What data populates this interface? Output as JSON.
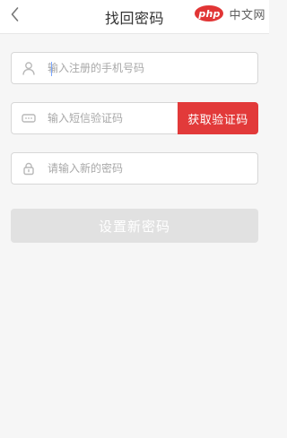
{
  "header": {
    "title": "找回密码",
    "back_icon": "chevron-left-icon"
  },
  "watermark": {
    "oval_text": "php",
    "text": "中文网"
  },
  "form": {
    "phone": {
      "icon": "user-icon",
      "placeholder": "输入注册的手机号码",
      "value": ""
    },
    "sms_code": {
      "icon": "sms-code-icon",
      "placeholder": "输入短信验证码",
      "value": ""
    },
    "get_code_button": {
      "label": "获取验证码",
      "color": "#e23a3a"
    },
    "new_password": {
      "icon": "lock-icon",
      "placeholder": "请输入新的密码",
      "value": ""
    }
  },
  "submit": {
    "label": "设置新密码",
    "color": "#e1e1e1"
  }
}
